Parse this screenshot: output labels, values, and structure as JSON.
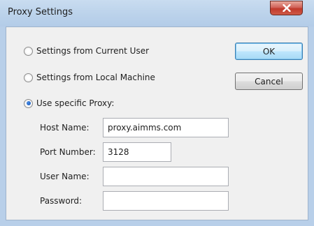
{
  "window": {
    "title": "Proxy Settings"
  },
  "radios": [
    {
      "label": "Settings from Current User",
      "checked": false
    },
    {
      "label": "Settings from Local Machine",
      "checked": false
    },
    {
      "label": "Use specific Proxy:",
      "checked": true
    }
  ],
  "fields": {
    "host": {
      "label": "Host Name:",
      "value": "proxy.aimms.com"
    },
    "port": {
      "label": "Port Number:",
      "value": "3128"
    },
    "user": {
      "label": "User Name:",
      "value": ""
    },
    "password": {
      "label": "Password:",
      "value": ""
    }
  },
  "buttons": {
    "ok": "OK",
    "cancel": "Cancel"
  },
  "icons": {
    "close": "close-icon"
  },
  "colors": {
    "close_button": "#c0392b",
    "default_button_border": "#3c7fb1"
  }
}
